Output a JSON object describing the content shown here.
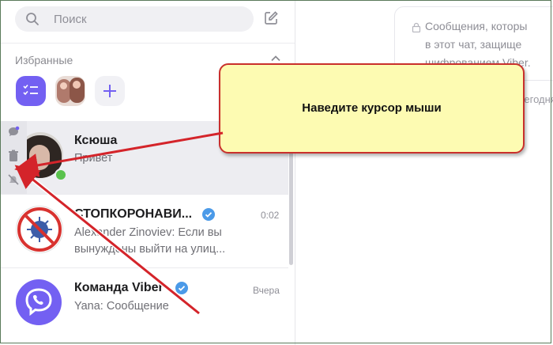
{
  "search": {
    "placeholder": "Поиск"
  },
  "favorites": {
    "title": "Избранные"
  },
  "chats": [
    {
      "name": "Ксюша",
      "message": "Привет",
      "time": ""
    },
    {
      "name": "СТОПКОРОНАВИ...",
      "message_line1": "Alexander Zinoviev: Если вы",
      "message_line2": "вынуждены выйти на улиц...",
      "time": "0:02"
    },
    {
      "name": "Команда Viber",
      "message": "Yana: Сообщение",
      "time": "Вчера"
    }
  ],
  "notice": {
    "line1": "Сообщения, которы",
    "line2": "в этот чат, защище",
    "line3": "шифрованием Viber."
  },
  "date_hint": "Сегодня",
  "callout": {
    "text": "Наведите курсор мыши"
  },
  "colors": {
    "accent": "#7360f2",
    "online": "#5ac24d",
    "callout_border": "#c9302c",
    "callout_bg": "#fdfbb2",
    "arrow": "#d4242a"
  }
}
